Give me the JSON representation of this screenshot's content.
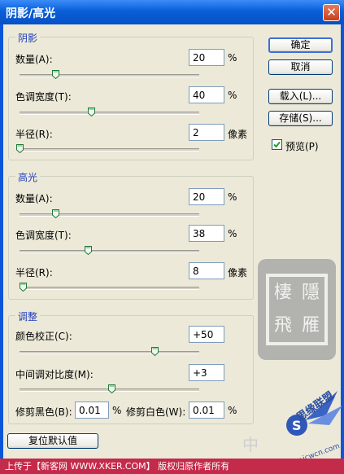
{
  "window": {
    "title": "阴影/高光",
    "close_glyph": "✕"
  },
  "shadows": {
    "legend": "阴影",
    "rows": [
      {
        "label": "数量(A):",
        "value": "20",
        "unit": "%",
        "slider_fraction": 0.2
      },
      {
        "label": "色调宽度(T):",
        "value": "40",
        "unit": "%",
        "slider_fraction": 0.4
      },
      {
        "label": "半径(R):",
        "value": "2",
        "unit": "像素",
        "slider_fraction": 0.0
      }
    ]
  },
  "highlights": {
    "legend": "高光",
    "rows": [
      {
        "label": "数量(A):",
        "value": "20",
        "unit": "%",
        "slider_fraction": 0.2
      },
      {
        "label": "色调宽度(T):",
        "value": "38",
        "unit": "%",
        "slider_fraction": 0.38
      },
      {
        "label": "半径(R):",
        "value": "8",
        "unit": "像素",
        "slider_fraction": 0.02
      }
    ]
  },
  "adjustments": {
    "legend": "调整",
    "color_correction": {
      "label": "颜色校正(C):",
      "value": "+50",
      "slider_fraction": 0.75
    },
    "midtone_contrast": {
      "label": "中间调对比度(M):",
      "value": "+3",
      "slider_fraction": 0.51
    },
    "black_clip": {
      "label": "修剪黑色(B):",
      "value": "0.01",
      "unit": "%"
    },
    "white_clip": {
      "label": "修剪白色(W):",
      "value": "0.01",
      "unit": "%"
    }
  },
  "buttons": {
    "ok": "确定",
    "cancel": "取消",
    "load": "载入(L)...",
    "save": "存储(S)...",
    "reset_defaults": "复位默认值"
  },
  "preview": {
    "label": "预览(P)",
    "checked": true
  },
  "watermark": {
    "chars": [
      "棲",
      "飛",
      "雁",
      "隱"
    ]
  },
  "footer": {
    "upload_text": "上传于【新客网 WWW.XKER.COM】 版权归原作者所有",
    "faint_text": "中",
    "logo_text": "思缘联盟",
    "site_text": "www.jcwcn.com"
  },
  "colors": {
    "title_bar": "#0a5fd8",
    "legend_text": "#1f3fbf",
    "status_bar": "#c42a4a"
  }
}
